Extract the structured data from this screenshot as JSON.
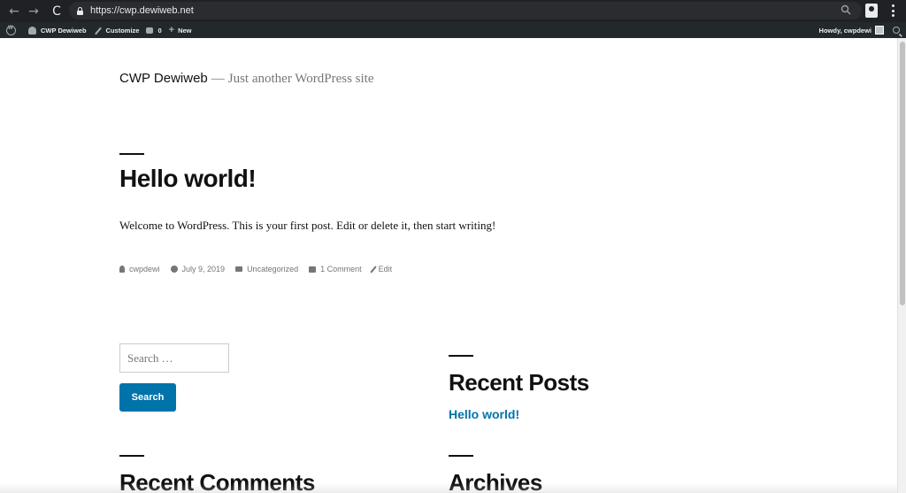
{
  "browser": {
    "url": "https://cwp.dewiweb.net",
    "back_glyph": "←",
    "forward_glyph": "→",
    "reload_glyph": "C"
  },
  "admin_bar": {
    "site_name": "CWP Dewiweb",
    "customize": "Customize",
    "comments_count": "0",
    "new_label": "New",
    "howdy": "Howdy, cwpdewi"
  },
  "site": {
    "title": "CWP Dewiweb",
    "separator": "—",
    "description": "Just another WordPress site"
  },
  "post": {
    "title": "Hello world!",
    "content": "Welcome to WordPress. This is your first post. Edit or delete it, then start writing!",
    "meta": {
      "author": "cwpdewi",
      "date": "July 9, 2019",
      "category": "Uncategorized",
      "comments": "1 Comment",
      "edit": "Edit"
    }
  },
  "search": {
    "placeholder": "Search …",
    "button": "Search"
  },
  "widgets": {
    "recent_posts_title": "Recent Posts",
    "recent_post_link": "Hello world!",
    "recent_comments_title": "Recent Comments",
    "archives_title": "Archives"
  },
  "colors": {
    "accent": "#0073aa",
    "admin_bar": "#23282d",
    "browser_chrome": "#202124"
  }
}
